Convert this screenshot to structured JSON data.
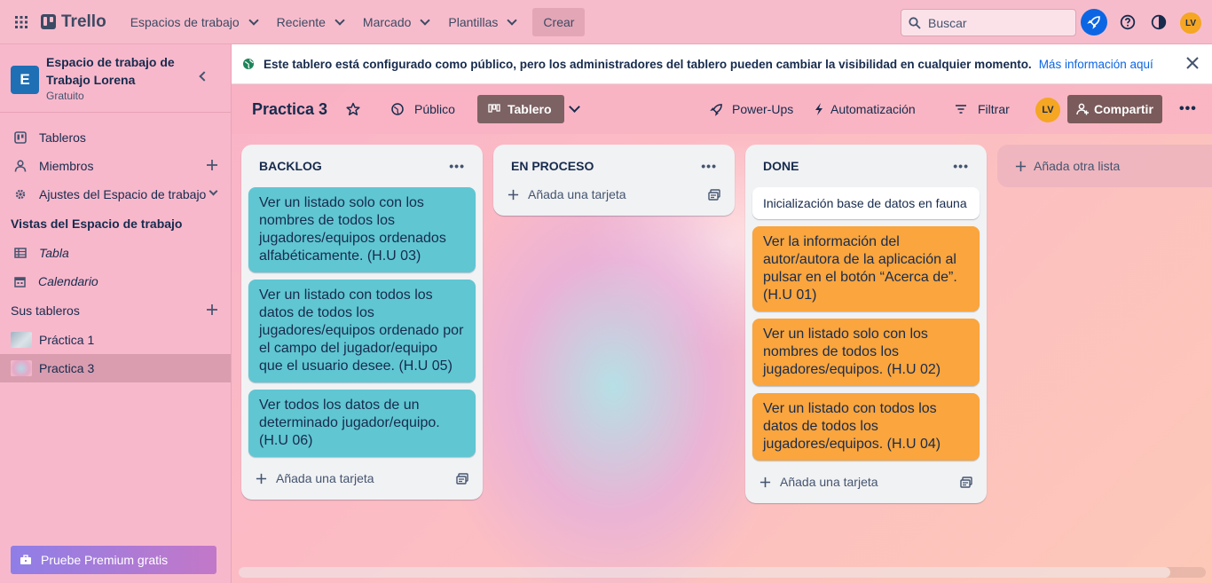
{
  "topbar": {
    "logo": "Trello",
    "nav": [
      "Espacios de trabajo",
      "Reciente",
      "Marcado",
      "Plantillas"
    ],
    "create": "Crear",
    "search_placeholder": "Buscar",
    "avatar": "LV",
    "icons": [
      "apps-grid-icon",
      "rocket-icon",
      "help-icon",
      "theme-icon"
    ]
  },
  "sidebar": {
    "workspace_initial": "E",
    "workspace_name": "Espacio de trabajo de Trabajo Lorena",
    "workspace_plan": "Gratuito",
    "items": [
      {
        "label": "Tableros",
        "icon": "board-icon"
      },
      {
        "label": "Miembros",
        "icon": "person-icon"
      },
      {
        "label": "Ajustes del Espacio de trabajo",
        "icon": "gear-icon"
      }
    ],
    "views_title": "Vistas del Espacio de trabajo",
    "views": [
      {
        "label": "Tabla",
        "icon": "table-icon"
      },
      {
        "label": "Calendario",
        "icon": "calendar-icon"
      }
    ],
    "boards_title": "Sus tableros",
    "boards": [
      "Práctica 1",
      "Practica 3"
    ],
    "premium": "Pruebe Premium gratis"
  },
  "banner": {
    "text": "Este tablero está configurado como público, pero los administradores del tablero pueden cambiar la visibilidad en cualquier momento.",
    "link": "Más información aquí"
  },
  "board": {
    "title": "Practica 3",
    "visibility": "Público",
    "view": "Tablero",
    "powerups": "Power-Ups",
    "automation": "Automatización",
    "filter": "Filtrar",
    "avatar": "LV",
    "share": "Compartir",
    "add_list": "Añada otra lista",
    "lists": [
      {
        "title": "BACKLOG",
        "add_card": "Añada una tarjeta",
        "cards": [
          {
            "text": "Ver un listado solo con los nombres de todos los jugadores/equipos ordenados alfabéticamente. (H.U 03)",
            "color": "#60c6d2"
          },
          {
            "text": "Ver un listado con todos los datos de todos los jugadores/equipos ordenado por el campo del jugador/equipo que el usuario desee. (H.U 05)",
            "color": "#60c6d2"
          },
          {
            "text": "Ver todos los datos de un determinado jugador/equipo. (H.U 06)",
            "color": "#60c6d2"
          }
        ]
      },
      {
        "title": "EN PROCESO",
        "add_card": "Añada una tarjeta",
        "cards": []
      },
      {
        "title": "DONE",
        "add_card": "Añada una tarjeta",
        "cards": [
          {
            "text": "Inicialización base de datos en fauna",
            "color": "#ffffff"
          },
          {
            "text": "Ver la información del autor/autora de la aplicación al pulsar en el botón “Acerca de”. (H.U 01)",
            "color": "#faa53d"
          },
          {
            "text": "Ver un listado solo con los nombres de todos los jugadores/equipos. (H.U 02)",
            "color": "#faa53d"
          },
          {
            "text": "Ver un listado con todos los datos de todos los jugadores/equipos. (H.U 04)",
            "color": "#faa53d"
          }
        ]
      }
    ]
  }
}
